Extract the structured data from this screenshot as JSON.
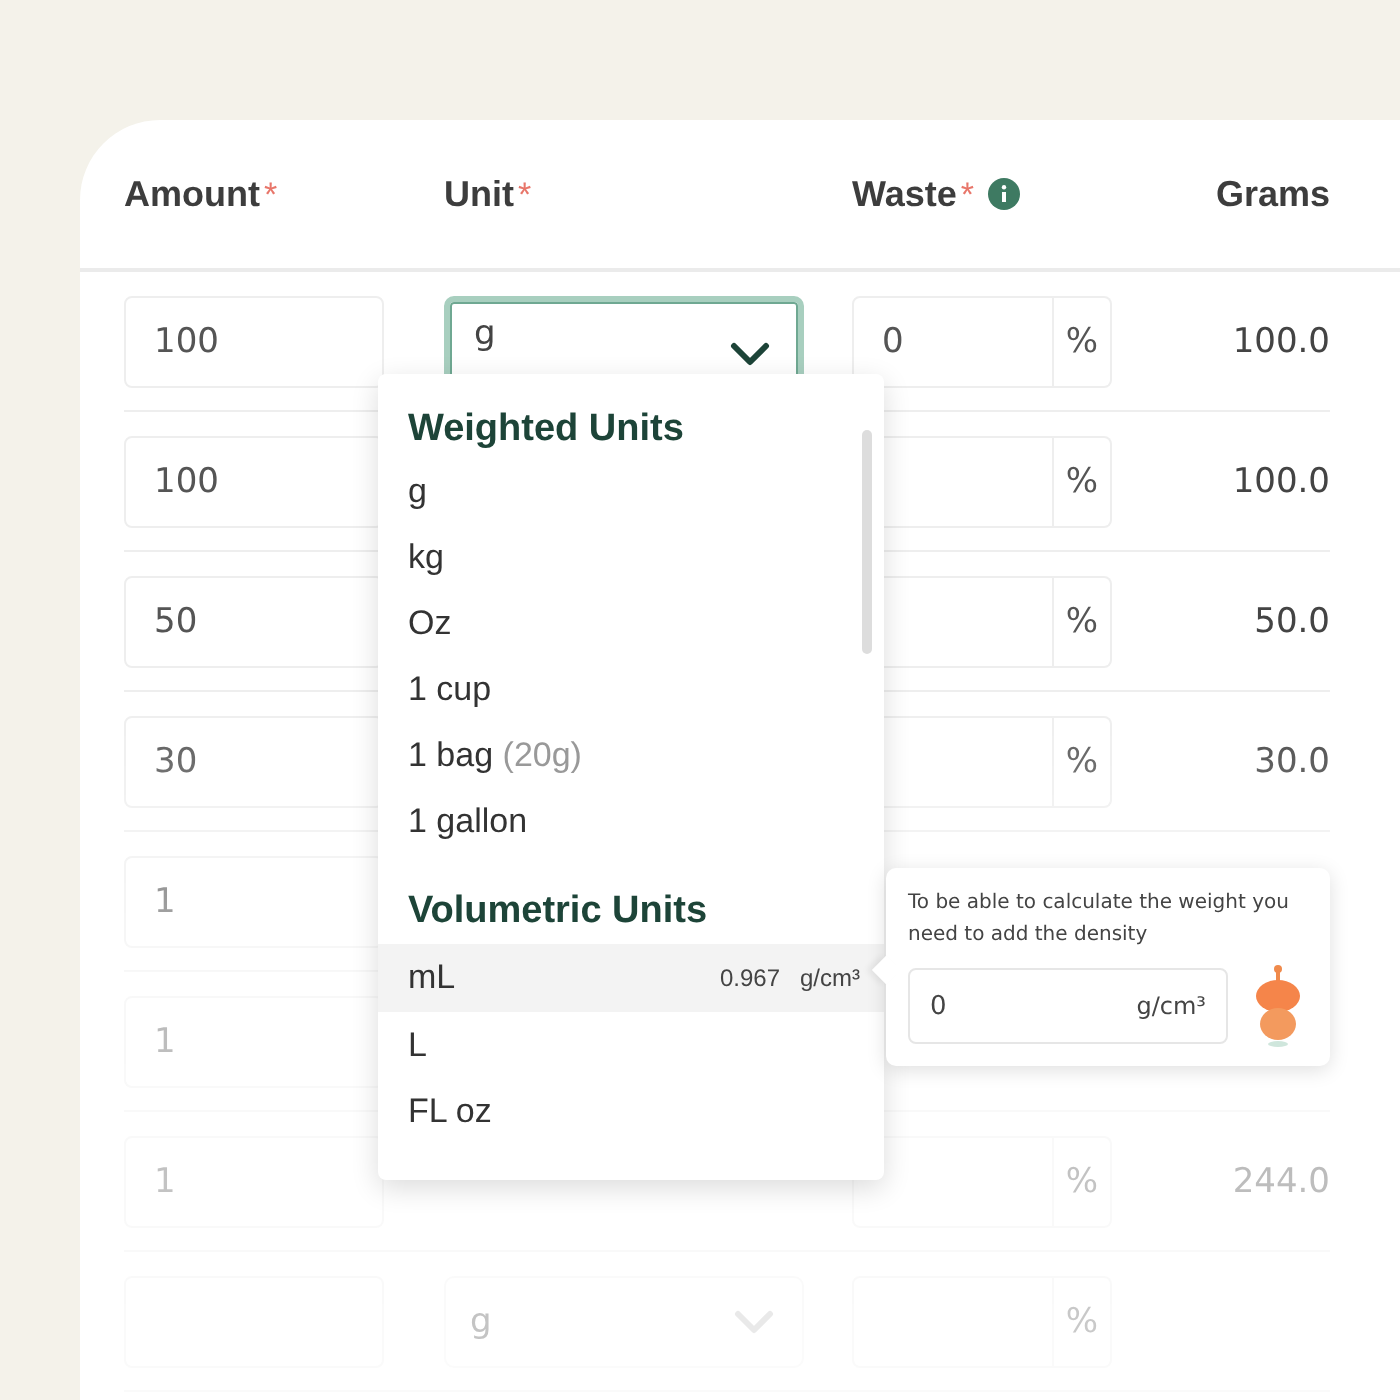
{
  "columns": [
    {
      "label": "Amount",
      "required_mark": "*"
    },
    {
      "label": "Unit",
      "required_mark": "*"
    },
    {
      "label": "Waste",
      "required_mark": "*",
      "info": true
    },
    {
      "label": "Grams"
    }
  ],
  "rows": [
    {
      "amount": "100",
      "unit": "g",
      "focused": true,
      "waste": "0",
      "waste_unit": "%",
      "grams": "100.0"
    },
    {
      "amount": "100",
      "waste_unit": "%",
      "grams": "100.0"
    },
    {
      "amount": "50",
      "waste_unit": "%",
      "grams": "50.0"
    },
    {
      "amount": "30",
      "waste_unit": "%",
      "grams": "30.0"
    },
    {
      "amount": "1"
    },
    {
      "amount": "1"
    },
    {
      "amount": "1",
      "waste_unit": "%",
      "grams": "244.0"
    },
    {
      "unit": "g",
      "focused": false,
      "waste_unit": "%"
    }
  ],
  "unit_menu": {
    "groups": [
      {
        "title": "Weighted Units",
        "items": [
          {
            "label": "g",
            "selected": false
          },
          {
            "label": "kg",
            "selected": false
          },
          {
            "label": "Oz",
            "selected": false
          },
          {
            "label": "1 cup",
            "selected": false
          },
          {
            "label": "1 bag",
            "note": "(20g)",
            "selected": false
          },
          {
            "label": "1 gallon",
            "selected": false
          }
        ]
      },
      {
        "title": "Volumetric Units",
        "items": [
          {
            "label": "mL",
            "density": "0.967",
            "density_unit": "g/cm³",
            "selected": true
          },
          {
            "label": "L",
            "selected": false
          },
          {
            "label": "FL oz",
            "selected": false
          }
        ]
      }
    ]
  },
  "density_tooltip": {
    "text": "To be able to calculate the weight you need to add the density",
    "value": "0",
    "unit": "g/cm³"
  }
}
